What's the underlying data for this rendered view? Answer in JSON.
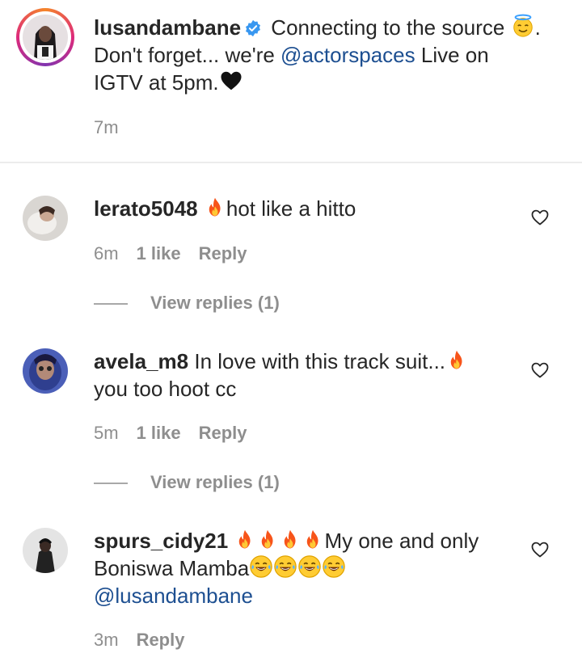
{
  "caption": {
    "username": "lusandambane",
    "text_part1": "Connecting to the source",
    "text_part1_end": ".",
    "line2_prefix": "Don't forget... we're",
    "mention": "@actorspaces",
    "line2_suffix": "Live on",
    "line3": "IGTV at 5pm.",
    "time": "7m"
  },
  "comments": [
    {
      "username": "lerato5048",
      "line1": "hot like a hitto",
      "time": "6m",
      "likes": "1 like",
      "reply": "Reply",
      "view_replies": "View replies (1)"
    },
    {
      "username": "avela_m8",
      "line1": "In love with this track suit...",
      "line2": "you too hoot cc",
      "time": "5m",
      "likes": "1 like",
      "reply": "Reply",
      "view_replies": "View replies (1)"
    },
    {
      "username": "spurs_cidy21",
      "line1": "My one and only",
      "line2": "Boniswa Mamba",
      "mention": "@lusandambane",
      "time": "3m",
      "reply": "Reply"
    }
  ],
  "icons": {
    "verified": "verified-badge-icon",
    "heart": "heart-outline-icon",
    "fire": "fire-emoji-icon",
    "halo": "halo-emoji-icon",
    "black_heart": "black-heart-emoji-icon",
    "laugh": "tears-of-joy-emoji-icon"
  },
  "colors": {
    "mention": "#1d4f91",
    "verified": "#3897f0",
    "meta": "#8e8e8e"
  }
}
